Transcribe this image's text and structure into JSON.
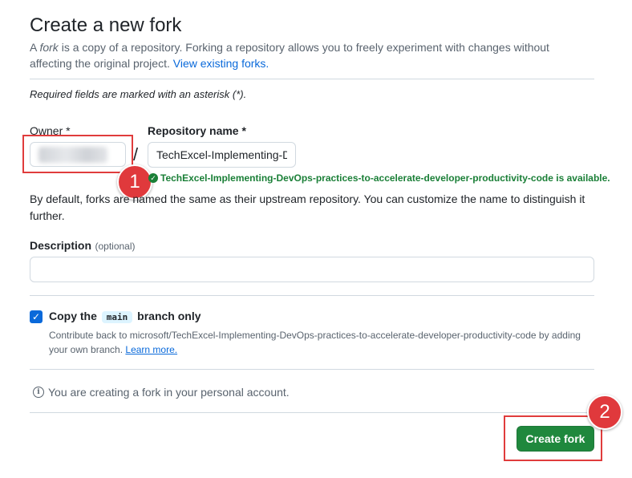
{
  "header": {
    "title": "Create a new fork",
    "intro_prefix": "A ",
    "intro_fork_word": "fork",
    "intro_rest": " is a copy of a repository. Forking a repository allows you to freely experiment with changes without affecting the original project. ",
    "view_forks_link": "View existing forks."
  },
  "form": {
    "required_note": "Required fields are marked with an asterisk (*).",
    "owner_label": "Owner *",
    "separator": "/",
    "repo_label": "Repository name *",
    "repo_value": "TechExcel-Implementing-DevOps-practices-to-accelerate-developer-productivity-code",
    "availability": "TechExcel-Implementing-DevOps-practices-to-accelerate-developer-productivity-code is available.",
    "naming_help": "By default, forks are named the same as their upstream repository. You can customize the name to distinguish it further.",
    "description_label": "Description",
    "description_optional": "(optional)",
    "description_value": "",
    "copy_branch_prefix": "Copy the ",
    "copy_branch_code": "main",
    "copy_branch_suffix": " branch only",
    "copy_branch_checked": true,
    "copy_branch_help": "Contribute back to microsoft/TechExcel-Implementing-DevOps-practices-to-accelerate-developer-productivity-code by adding your own branch. ",
    "learn_more": "Learn more.",
    "account_note": "You are creating a fork in your personal account.",
    "submit_label": "Create fork"
  },
  "annotations": {
    "badge_1": "1",
    "badge_2": "2",
    "accent_color": "#e0393c"
  },
  "colors": {
    "primary_button": "#1f883d",
    "link": "#0969da",
    "success": "#1a7f37"
  }
}
